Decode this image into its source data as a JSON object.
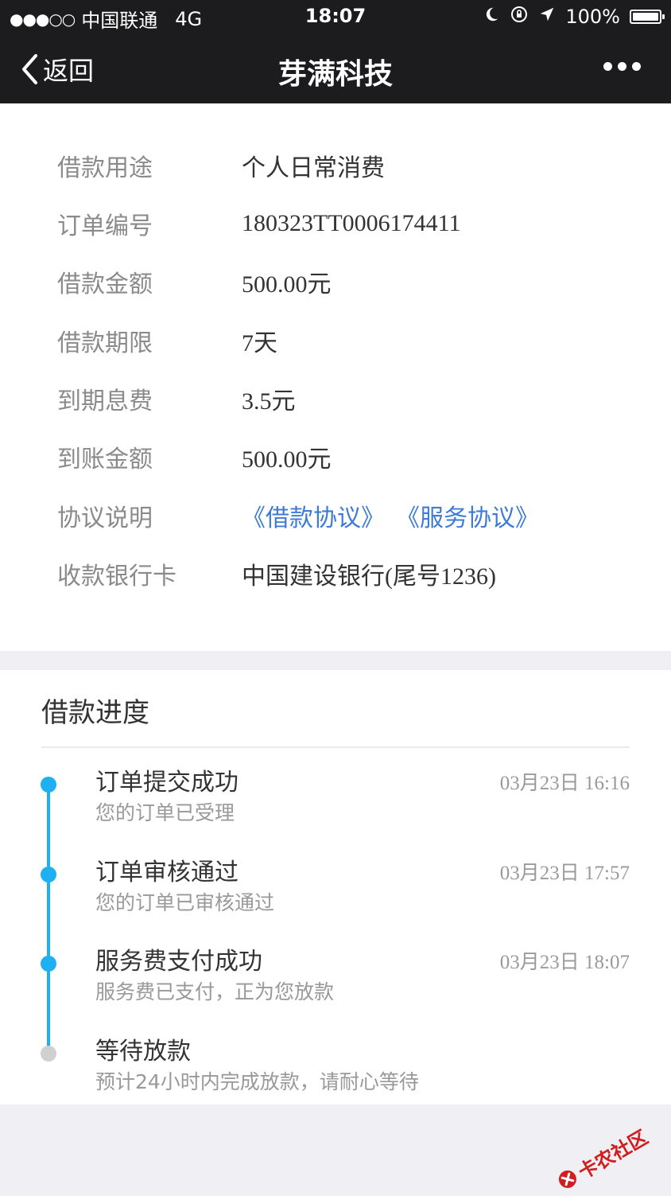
{
  "status_bar": {
    "carrier": "中国联通",
    "network": "4G",
    "time": "18:07",
    "battery": "100%"
  },
  "nav": {
    "back_label": "返回",
    "title": "芽满科技"
  },
  "details": [
    {
      "label": "借款用途",
      "value": "个人日常消费"
    },
    {
      "label": "订单编号",
      "value": "180323TT0006174411"
    },
    {
      "label": "借款金额",
      "value": "500.00元"
    },
    {
      "label": "借款期限",
      "value": "7天"
    },
    {
      "label": "到期息费",
      "value": "3.5元"
    },
    {
      "label": "到账金额",
      "value": "500.00元"
    },
    {
      "label": "协议说明",
      "links": [
        "《借款协议》",
        "《服务协议》"
      ]
    },
    {
      "label": "收款银行卡",
      "value": "中国建设银行(尾号1236)"
    }
  ],
  "progress": {
    "title": "借款进度",
    "steps": [
      {
        "title": "订单提交成功",
        "desc": "您的订单已受理",
        "time": "03月23日 16:16",
        "done": true
      },
      {
        "title": "订单审核通过",
        "desc": "您的订单已审核通过",
        "time": "03月23日 17:57",
        "done": true
      },
      {
        "title": "服务费支付成功",
        "desc": "服务费已支付，正为您放款",
        "time": "03月23日 18:07",
        "done": true
      },
      {
        "title": "等待放款",
        "desc": "预计24小时内完成放款，请耐心等待",
        "time": "",
        "done": false
      }
    ]
  },
  "watermark": {
    "text": "卡农社区"
  },
  "colors": {
    "accent": "#1eb0f0",
    "link": "#3d7bd6",
    "pending": "#d0d0d0",
    "topbar": "#1c1c1e"
  }
}
